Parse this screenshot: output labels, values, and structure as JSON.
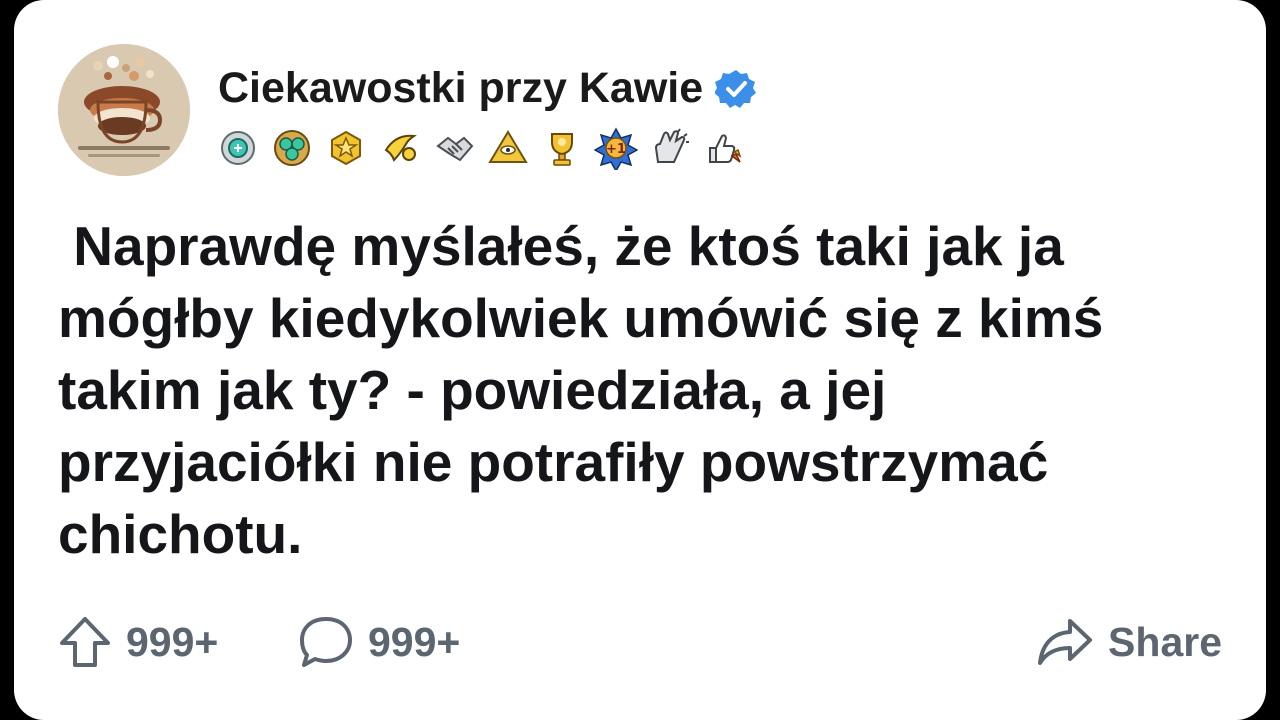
{
  "post": {
    "author": "Ciekawostki przy Kawie",
    "verified_icon": "verified-check-icon",
    "badges": [
      "shield-badge-icon",
      "gem-cluster-badge-icon",
      "gold-star-badge-icon",
      "banana-badge-icon",
      "handshake-badge-icon",
      "pyramid-eye-badge-icon",
      "trophy-badge-icon",
      "plus-one-badge-icon",
      "clapping-hands-badge-icon",
      "thumbs-up-rocket-badge-icon"
    ],
    "text": " Naprawdę myślałeś, że ktoś taki jak ja\nmógłby kiedykolwiek umówić się z kimś\ntakim jak ty? - powiedziała, a jej\nprzyjaciółki nie potrafiły powstrzymać\nchichotu."
  },
  "actions": {
    "upvote_count": "999+",
    "comment_count": "999+",
    "share_label": "Share"
  },
  "colors": {
    "background": "#000000",
    "card": "#ffffff",
    "text": "#15161a",
    "muted": "#5b6670",
    "verified": "#3b8fe8",
    "avatar_bg": "#d9c9b1"
  }
}
